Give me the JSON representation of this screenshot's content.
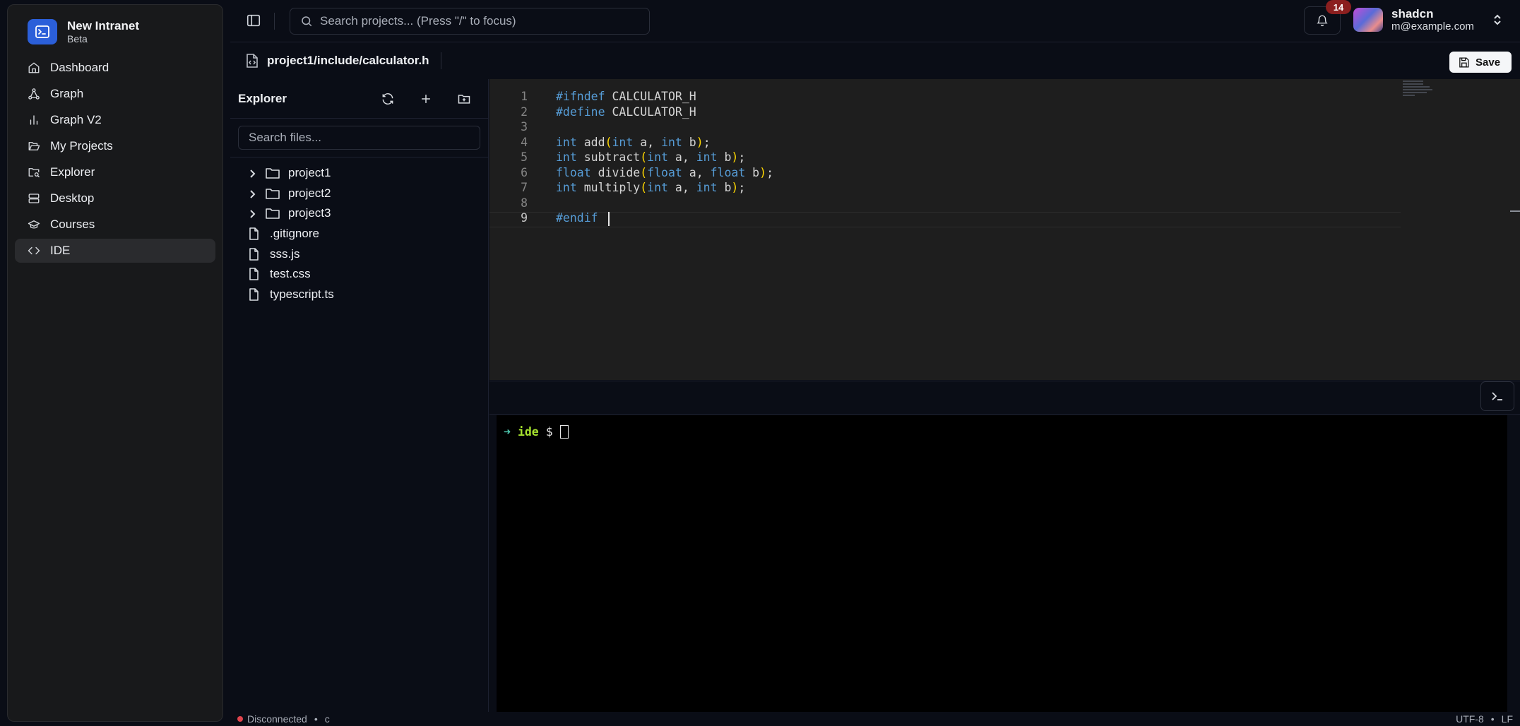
{
  "app": {
    "title": "New Intranet",
    "subtitle": "Beta"
  },
  "sidebar": {
    "items": [
      {
        "label": "Dashboard",
        "icon": "home-icon"
      },
      {
        "label": "Graph",
        "icon": "graph-icon"
      },
      {
        "label": "Graph V2",
        "icon": "bar-chart-icon"
      },
      {
        "label": "My Projects",
        "icon": "folder-open-icon"
      },
      {
        "label": "Explorer",
        "icon": "folder-search-icon"
      },
      {
        "label": "Desktop",
        "icon": "server-icon"
      },
      {
        "label": "Courses",
        "icon": "graduation-cap-icon"
      },
      {
        "label": "IDE",
        "icon": "code-icon",
        "active": true
      }
    ]
  },
  "topbar": {
    "search_placeholder": "Search projects... (Press \"/\" to focus)",
    "notifications_count": "14",
    "user_name": "shadcn",
    "user_email": "m@example.com"
  },
  "filebar": {
    "path": "project1/include/calculator.h",
    "save_label": "Save"
  },
  "explorer": {
    "title": "Explorer",
    "search_placeholder": "Search files...",
    "folders": [
      "project1",
      "project2",
      "project3"
    ],
    "files": [
      ".gitignore",
      "sss.js",
      "test.css",
      "typescript.ts"
    ]
  },
  "editor": {
    "current_line": 9,
    "lines": [
      "#ifndef CALCULATOR_H",
      "#define CALCULATOR_H",
      "",
      "int add(int a, int b);",
      "int subtract(int a, int b);",
      "float divide(float a, float b);",
      "int multiply(int a, int b);",
      "",
      "#endif"
    ]
  },
  "terminal": {
    "arrow": "➜",
    "dir": "ide",
    "prompt": "$"
  },
  "status": {
    "connection": "Disconnected",
    "language": "c",
    "encoding": "UTF-8",
    "line_ending": "LF",
    "bullet": "•"
  },
  "colors": {
    "brand": "#2b5fd9",
    "status_error": "#e0444d",
    "badge": "#8b1f1f"
  }
}
